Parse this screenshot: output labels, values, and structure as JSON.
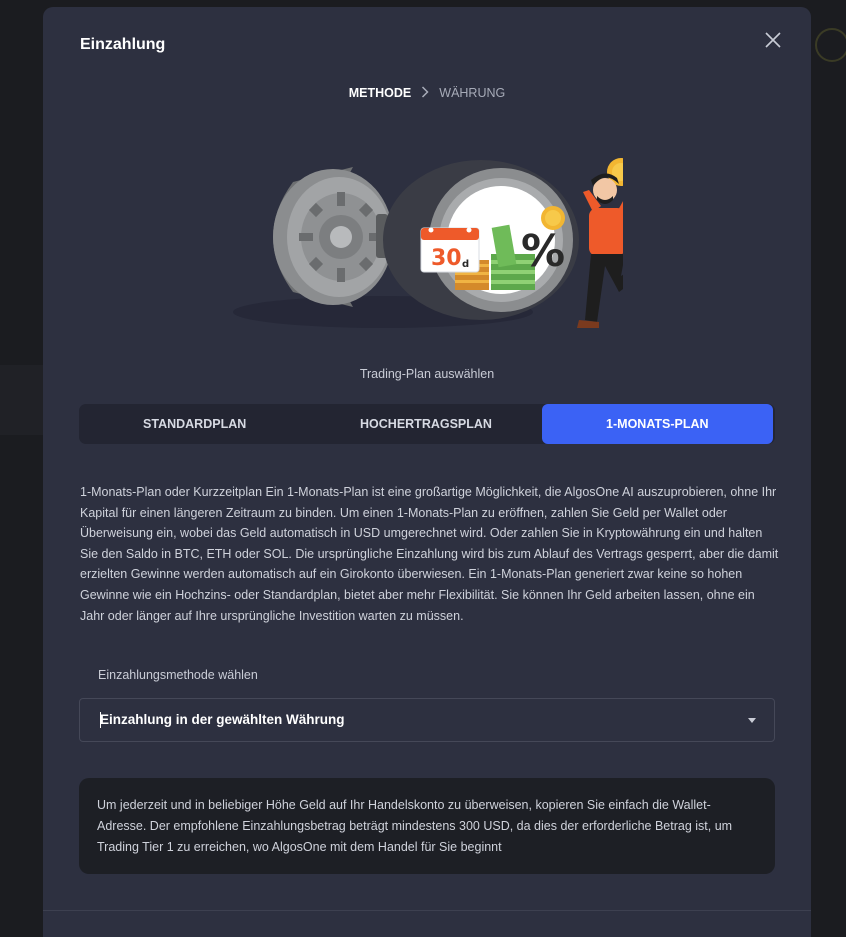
{
  "modal": {
    "title": "Einzahlung",
    "close_icon": "close-icon"
  },
  "steps": {
    "current": "METHODE",
    "next": "WÄHRUNG"
  },
  "hero": {
    "calendar_number": "30",
    "calendar_unit": "d",
    "percent_sign": "%"
  },
  "plan_caption": "Trading-Plan auswählen",
  "tabs": [
    {
      "label": "STANDARDPLAN",
      "active": false
    },
    {
      "label": "HOCHERTRAGSPLAN",
      "active": false
    },
    {
      "label": "1-MONATS-PLAN",
      "active": true
    }
  ],
  "description": "1-Monats-Plan oder Kurzzeitplan Ein 1-Monats-Plan ist eine großartige Möglichkeit, die AlgosOne AI auszuprobieren, ohne Ihr Kapital für einen längeren Zeitraum zu binden. Um einen 1-Monats-Plan zu eröffnen, zahlen Sie Geld per Wallet oder Überweisung ein, wobei das Geld automatisch in USD umgerechnet wird. Oder zahlen Sie in Kryptowährung ein und halten Sie den Saldo in BTC, ETH oder SOL. Die ursprüngliche Einzahlung wird bis zum Ablauf des Vertrags gesperrt, aber die damit erzielten Gewinne werden automatisch auf ein Girokonto überwiesen. Ein 1-Monats-Plan generiert zwar keine so hohen Gewinne wie ein Hochzins- oder Standardplan, bietet aber mehr Flexibilität. Sie können Ihr Geld arbeiten lassen, ohne ein Jahr oder länger auf Ihre ursprüngliche Investition warten zu müssen.",
  "method": {
    "label": "Einzahlungsmethode wählen",
    "selected": "Einzahlung in der gewählten Währung"
  },
  "info": "Um jederzeit und in beliebiger Höhe Geld auf Ihr Handelskonto zu überweisen, kopieren Sie einfach die Wallet-Adresse. Der empfohlene Einzahlungsbetrag beträgt mindestens 300 USD, da dies der erforderliche Betrag ist, um Trading Tier 1 zu erreichen, wo AlgosOne mit dem Handel für Sie beginnt",
  "colors": {
    "accent": "#3b62f5",
    "modal_bg": "#2d3040",
    "page_bg": "#1b1c20"
  }
}
